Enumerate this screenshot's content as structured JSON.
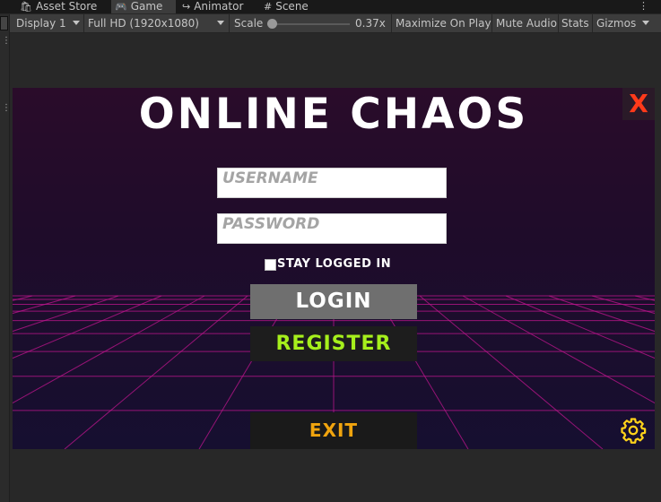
{
  "editor": {
    "tabs": [
      {
        "label": "Asset Store",
        "icon": "bag-icon"
      },
      {
        "label": "Game",
        "icon": "gamepad-icon",
        "active": true
      },
      {
        "label": "Animator",
        "icon": "animator-icon"
      },
      {
        "label": "Scene",
        "icon": "hash-icon"
      }
    ],
    "toolbar": {
      "display": "Display 1",
      "resolution": "Full HD (1920x1080)",
      "scale_label": "Scale",
      "scale_value": "0.37x",
      "maximize": "Maximize On Play",
      "mute": "Mute Audio",
      "stats": "Stats",
      "gizmos": "Gizmos"
    }
  },
  "game": {
    "title": "Online Chaos",
    "close_glyph": "X",
    "username_placeholder": "Username",
    "password_placeholder": "Password",
    "stay_logged_in": "Stay logged in",
    "login": "Login",
    "register": "Register",
    "exit": "Exit",
    "colors": {
      "close": "#ff3a1a",
      "register": "#a6f01c",
      "exit": "#f0a40e",
      "gear": "#ffd21a",
      "grid": "#c0158f"
    }
  }
}
